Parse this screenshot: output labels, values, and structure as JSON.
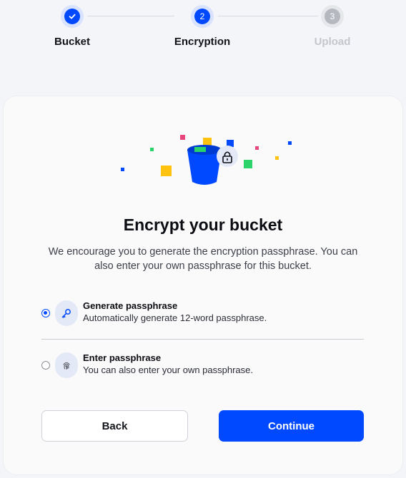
{
  "stepper": {
    "steps": [
      {
        "label": "Bucket",
        "number": "1",
        "state": "completed",
        "icon": "check-icon"
      },
      {
        "label": "Encryption",
        "number": "2",
        "state": "active"
      },
      {
        "label": "Upload",
        "number": "3",
        "state": "pending"
      }
    ]
  },
  "card": {
    "title": "Encrypt your bucket",
    "subtitle": "We encourage you to generate the encryption passphrase. You can also enter your own passphrase for this bucket.",
    "options": [
      {
        "title": "Generate passphrase",
        "description": "Automatically generate 12-word passphrase.",
        "selected": true,
        "icon": "key-icon"
      },
      {
        "title": "Enter passphrase",
        "description": "You can also enter your own passphrase.",
        "selected": false,
        "icon": "fingerprint-icon"
      }
    ],
    "back_label": "Back",
    "continue_label": "Continue"
  },
  "colors": {
    "accent": "#0149ff",
    "background": "#f4f5f8",
    "card": "#fafafb"
  }
}
